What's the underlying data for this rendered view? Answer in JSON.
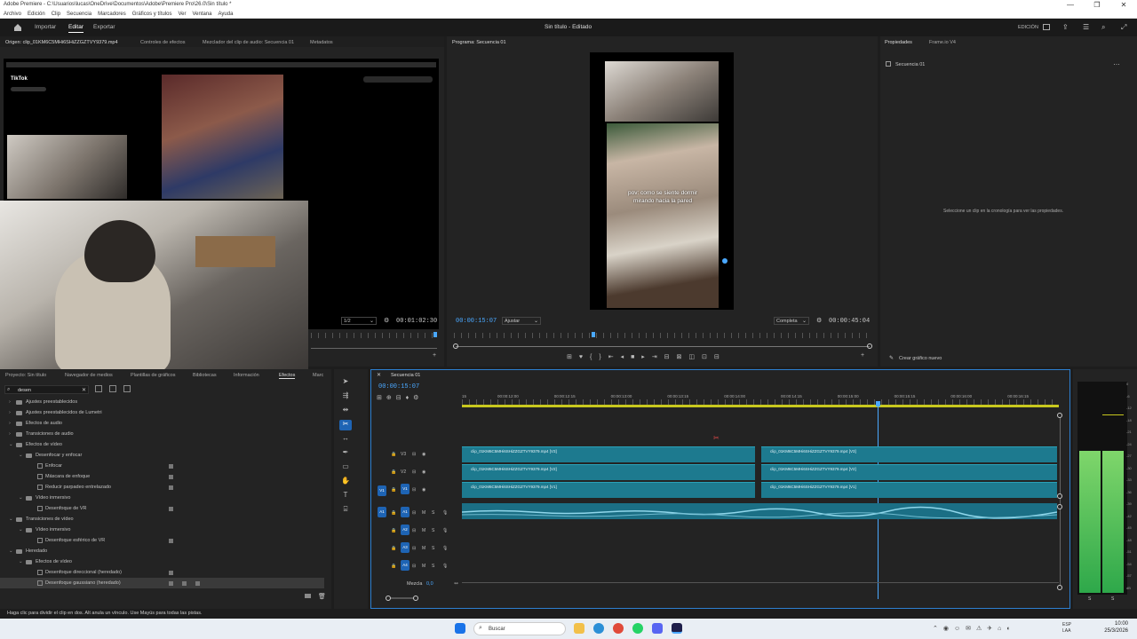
{
  "window": {
    "title": "Adobe Premiere - C:\\Usuarios\\lucas\\OneDrive\\Documentos\\Adobe\\Premiere Pro\\26.0\\Sin título *",
    "minimize": "—",
    "maximize": "❐",
    "close": "✕"
  },
  "menu": [
    "Archivo",
    "Edición",
    "Clip",
    "Secuencia",
    "Marcadores",
    "Gráficos y títulos",
    "Ver",
    "Ventana",
    "Ayuda"
  ],
  "appbar": {
    "home_icon": "home-icon",
    "import": "Importar",
    "edit": "Editar",
    "export": "Exportar",
    "project_title": "Sin título - Editado",
    "workspace": "EDICIÓN"
  },
  "source_tabs": [
    "Origen: clip_01KM6C5MHi6SHiZZGZTVY9379.mp4",
    "Controles de efectos",
    "Mezclador del clip de audio: Secuencia 01",
    "Metadatos"
  ],
  "source": {
    "resolution": "1/2",
    "duration": "00:01:02:30",
    "tiktok": "TikTok"
  },
  "program": {
    "tab": "Programa: Secuencia 01",
    "timecode": "00:00:15:07",
    "fit": "Ajustar",
    "quality": "Completa",
    "duration": "00:00:45:04",
    "caption": "pov: como se siente dormir mirando hacia la pared"
  },
  "properties": {
    "tabs": [
      "Propiedades",
      "Frame.io V4"
    ],
    "sequence": "Secuencia 01",
    "empty_message": "Seleccione un clip en la cronología para ver las propiedades.",
    "new_graphic": "Crear gráfico nuevo"
  },
  "project": {
    "tabs": [
      "Proyecto: Sin título",
      "Navegador de medios",
      "Plantillas de gráficos",
      "Bibliotecas",
      "Información",
      "Efectos",
      "Marc"
    ],
    "search": "desen"
  },
  "effects_tree": [
    {
      "label": "Ajustes preestablecidos",
      "lvl": 0,
      "type": "folder",
      "open": false
    },
    {
      "label": "Ajustes preestablecidos de Lumetri",
      "lvl": 0,
      "type": "folder",
      "open": false
    },
    {
      "label": "Efectos de audio",
      "lvl": 0,
      "type": "folder",
      "open": false
    },
    {
      "label": "Transiciones de audio",
      "lvl": 0,
      "type": "folder",
      "open": false
    },
    {
      "label": "Efectos de vídeo",
      "lvl": 0,
      "type": "folder",
      "open": true
    },
    {
      "label": "Desenfocar y enfocar",
      "lvl": 1,
      "type": "folder",
      "open": true
    },
    {
      "label": "Enfocar",
      "lvl": 2,
      "type": "fx",
      "badges": 1
    },
    {
      "label": "Máscara de enfoque",
      "lvl": 2,
      "type": "fx",
      "badges": 1
    },
    {
      "label": "Reducir parpadeo entrelazado",
      "lvl": 2,
      "type": "fx",
      "badges": 1
    },
    {
      "label": "Vídeo inmersivo",
      "lvl": 1,
      "type": "folder",
      "open": true
    },
    {
      "label": "Desenfoque de VR",
      "lvl": 2,
      "type": "fx",
      "badges": 1
    },
    {
      "label": "Transiciones de vídeo",
      "lvl": 0,
      "type": "folder",
      "open": true
    },
    {
      "label": "Vídeo inmersivo",
      "lvl": 1,
      "type": "folder",
      "open": true
    },
    {
      "label": "Desenfoque esférico de VR",
      "lvl": 2,
      "type": "fx",
      "badges": 1
    },
    {
      "label": "Heredado",
      "lvl": 0,
      "type": "folder",
      "open": true
    },
    {
      "label": "Efectos de vídeo",
      "lvl": 1,
      "type": "folder",
      "open": true
    },
    {
      "label": "Desenfoque direccional (heredado)",
      "lvl": 2,
      "type": "fx",
      "badges": 1
    },
    {
      "label": "Desenfoque gaussiano (heredado)",
      "lvl": 2,
      "type": "fx",
      "badges": 3
    }
  ],
  "timeline": {
    "tab": "Secuencia 01",
    "timecode": "00:00:15:07",
    "ruler": [
      "15",
      "00:00:12:00",
      "00:00:12:15",
      "00:00:13:00",
      "00:00:13:15",
      "00:00:14:00",
      "00:00:14:15",
      "00:00:15:00",
      "00:00:15:15",
      "00:00:16:00",
      "00:00:16:15"
    ],
    "video_tracks": [
      "V3",
      "V2",
      "V1"
    ],
    "audio_tracks": [
      "A1",
      "A2",
      "A3",
      "A4"
    ],
    "mix": "Mezcla",
    "mix_value": "0,0",
    "clips": [
      {
        "track": "V3",
        "a": "clip_01KM6C5MHi6SHiZZGZTVY9379.mp4 [V3]",
        "b": "clip_01KM6C5MHi6SHiZZGZTVY9379.mp4 [V3]"
      },
      {
        "track": "V2",
        "a": "clip_01KM6C5MHi6SHiZZGZTVY9379.mp4 [V2]",
        "b": "clip_01KM6C5MHi6SHiZZGZTVY9379.mp4 [V2]"
      },
      {
        "track": "V1",
        "a": "clip_01KM6C5MHi6SHiZZGZTVY9379.mp4 [V1]",
        "b": "clip_01KM6C5MHi6SHiZZGZTVY9379.mp4 [V1]"
      }
    ]
  },
  "meter": {
    "labels": [
      "0",
      "-6",
      "-12",
      "-18",
      "-21",
      "-24",
      "-27",
      "-30",
      "-33",
      "-36",
      "-39",
      "-42",
      "-45",
      "-48",
      "-51",
      "-54",
      "-57",
      "dB"
    ],
    "l": "S",
    "r": "S"
  },
  "status": "Haga clic para dividir el clip en dos. Alt anula un vínculo. Use Mayús para todas las pistas.",
  "taskbar": {
    "search": "Buscar",
    "lang": "ESP\nLAA",
    "time": "10:00",
    "date": "25/3/2026"
  },
  "colors": {
    "clip": "#1d7a8f",
    "accent": "#4aa8ff",
    "track_blue": "#1e64b4"
  }
}
